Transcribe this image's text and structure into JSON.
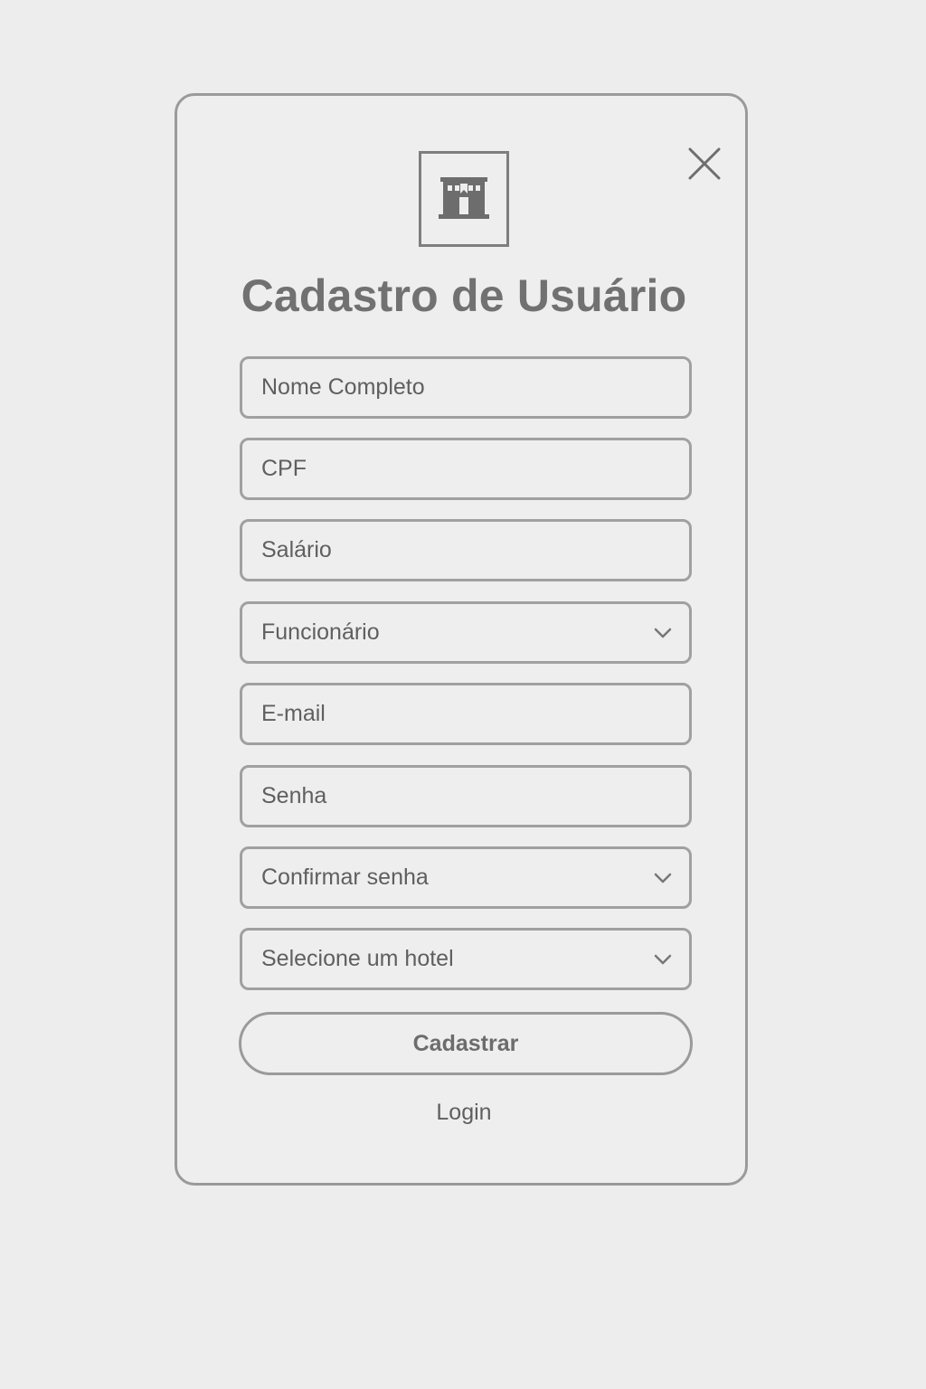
{
  "form": {
    "title": "Cadastro de Usuário",
    "logo_icon": "hotel-building-icon",
    "close_icon": "close-icon",
    "fields": [
      {
        "name": "full-name",
        "placeholder": "Nome Completo",
        "type": "text"
      },
      {
        "name": "cpf",
        "placeholder": "CPF",
        "type": "text"
      },
      {
        "name": "salary",
        "placeholder": "Salário",
        "type": "text"
      },
      {
        "name": "role",
        "value": "Funcionário",
        "type": "select"
      },
      {
        "name": "email",
        "placeholder": "E-mail",
        "type": "text"
      },
      {
        "name": "password",
        "placeholder": "Senha",
        "type": "password"
      },
      {
        "name": "confirm-password",
        "placeholder": "Confirmar senha",
        "type": "select"
      },
      {
        "name": "hotel",
        "placeholder": "Selecione um hotel",
        "type": "select"
      }
    ],
    "submit_label": "Cadastrar",
    "login_label": "Login"
  },
  "colors": {
    "background": "#ededed",
    "border": "#9a9a9a",
    "text": "#5f5f5f"
  }
}
